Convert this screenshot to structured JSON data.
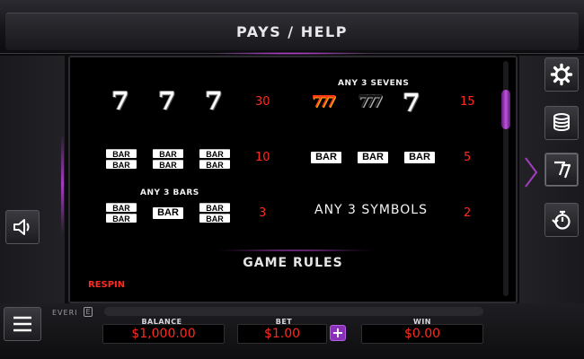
{
  "header": {
    "title": "PAYS / HELP"
  },
  "paytable": {
    "rows": [
      {
        "symbols": [
          "7",
          "7",
          "7"
        ],
        "payout": "30"
      },
      {
        "caption": "ANY 3 SEVENS",
        "symbols": [
          "777",
          "777",
          "7"
        ],
        "payout": "15"
      },
      {
        "symbols": [
          "BAR BAR",
          "BAR BAR",
          "BAR BAR"
        ],
        "payout": "10"
      },
      {
        "symbols": [
          "BAR",
          "BAR",
          "BAR"
        ],
        "payout": "5"
      },
      {
        "caption": "ANY 3 BARS",
        "symbols": [
          "BAR BAR",
          "BAR",
          "BAR BAR"
        ],
        "payout": "3"
      },
      {
        "caption": "ANY 3 SYMBOLS",
        "payout": "2"
      }
    ],
    "bar_text": "BAR",
    "seven_text": "7",
    "triple_seven_text": "777"
  },
  "rules": {
    "title": "GAME RULES",
    "first_section": "RESPIN"
  },
  "footer": {
    "brand": "EVERI",
    "brand_badge": "E",
    "balance_label": "BALANCE",
    "balance_value": "$1,000.00",
    "bet_label": "BET",
    "bet_value": "$1.00",
    "bet_plus": "+",
    "win_label": "WIN",
    "win_value": "$0.00"
  },
  "icons": {
    "right_buttons": [
      "gear-icon",
      "coin-stack-icon",
      "paytable-seven-icon",
      "timer-replay-icon"
    ],
    "left_buttons": [
      "speaker-icon",
      "hamburger-menu-icon"
    ]
  },
  "colors": {
    "accent": "#a43cc0",
    "value": "#ff2a1e"
  },
  "scroll": {
    "position": 0.12
  }
}
